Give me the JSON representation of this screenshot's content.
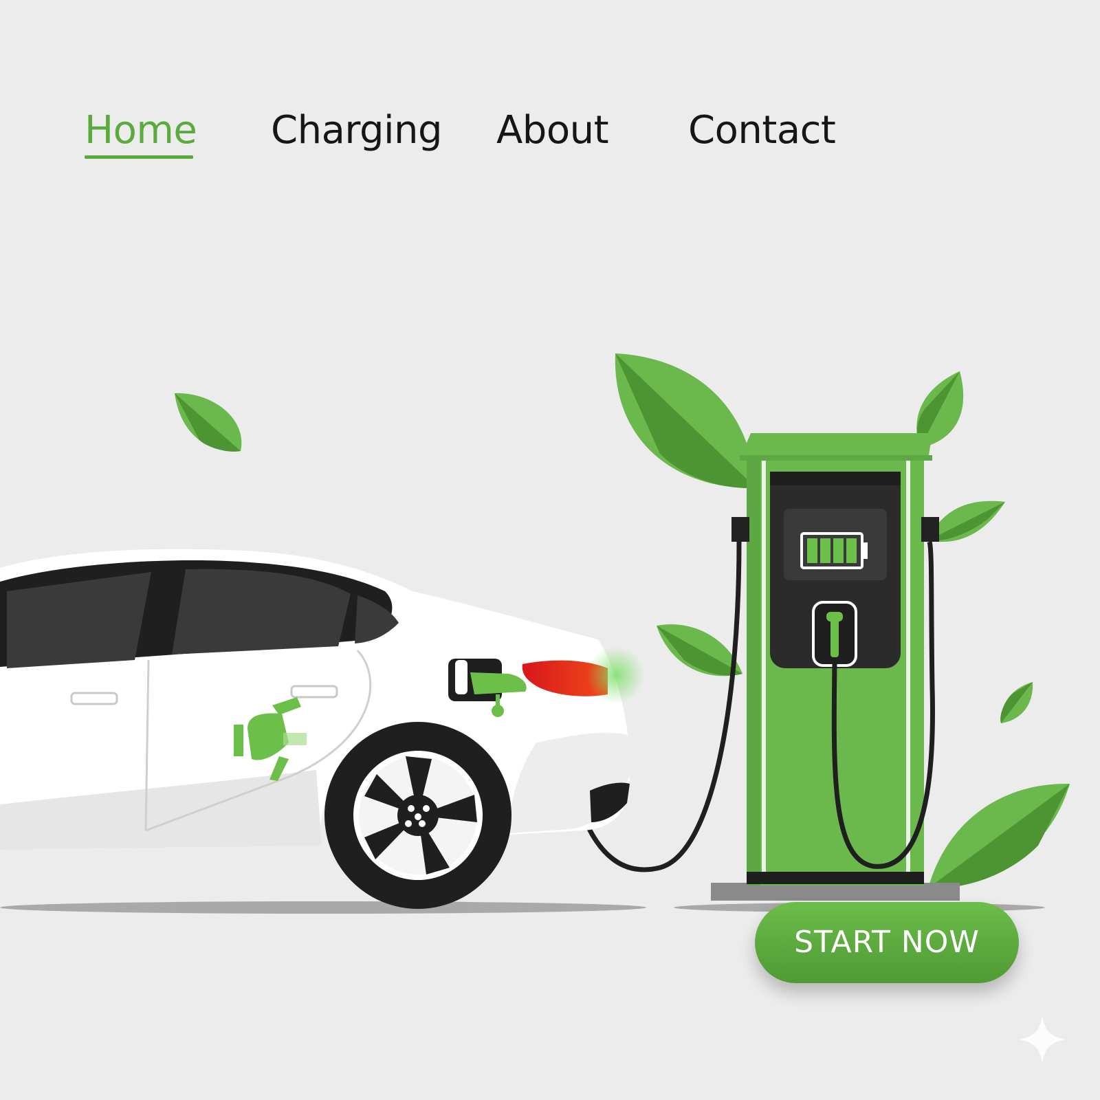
{
  "nav": {
    "items": [
      {
        "label": "Home",
        "active": true
      },
      {
        "label": "Charging",
        "active": false
      },
      {
        "label": "About",
        "active": false
      },
      {
        "label": "Contact",
        "active": false
      }
    ]
  },
  "hero": {
    "illustration": "electric-car-charging-station",
    "charger_battery_level_bars": 4,
    "charger_battery_level_total": 4,
    "cta_label": "START NOW"
  },
  "colors": {
    "accent": "#5aaa3e",
    "accent_dark": "#4a8f31",
    "background": "#ececec",
    "text": "#161616",
    "car_body": "#ffffff",
    "charger_panel": "#2b2b2b"
  },
  "icons": {
    "corner_mark": "sparkle-icon"
  }
}
